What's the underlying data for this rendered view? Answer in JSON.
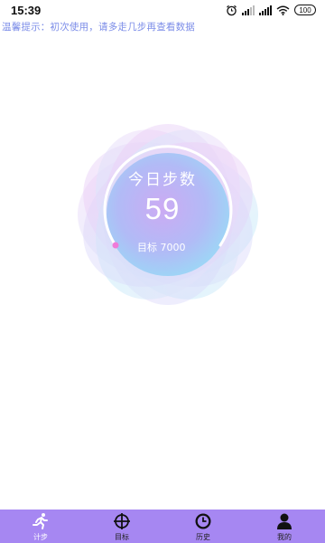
{
  "status_bar": {
    "time": "15:39",
    "battery": "100"
  },
  "tip": "温馨提示：初次使用，请多走几步再查看数据",
  "pedometer": {
    "today_label": "今日步数",
    "steps": "59",
    "goal_text": "目标 7000",
    "progress_fraction": 0.008
  },
  "tabs": [
    {
      "label": "计步",
      "icon": "running-icon",
      "active": true
    },
    {
      "label": "目标",
      "icon": "crosshair-icon",
      "active": false
    },
    {
      "label": "历史",
      "icon": "clock-icon",
      "active": false
    },
    {
      "label": "我的",
      "icon": "user-icon",
      "active": false
    }
  ],
  "colors": {
    "tab_bar": "#a687f2",
    "tip_text": "#7c8de8",
    "ring": "#ffffff",
    "progress_dot": "#f07bd8"
  }
}
